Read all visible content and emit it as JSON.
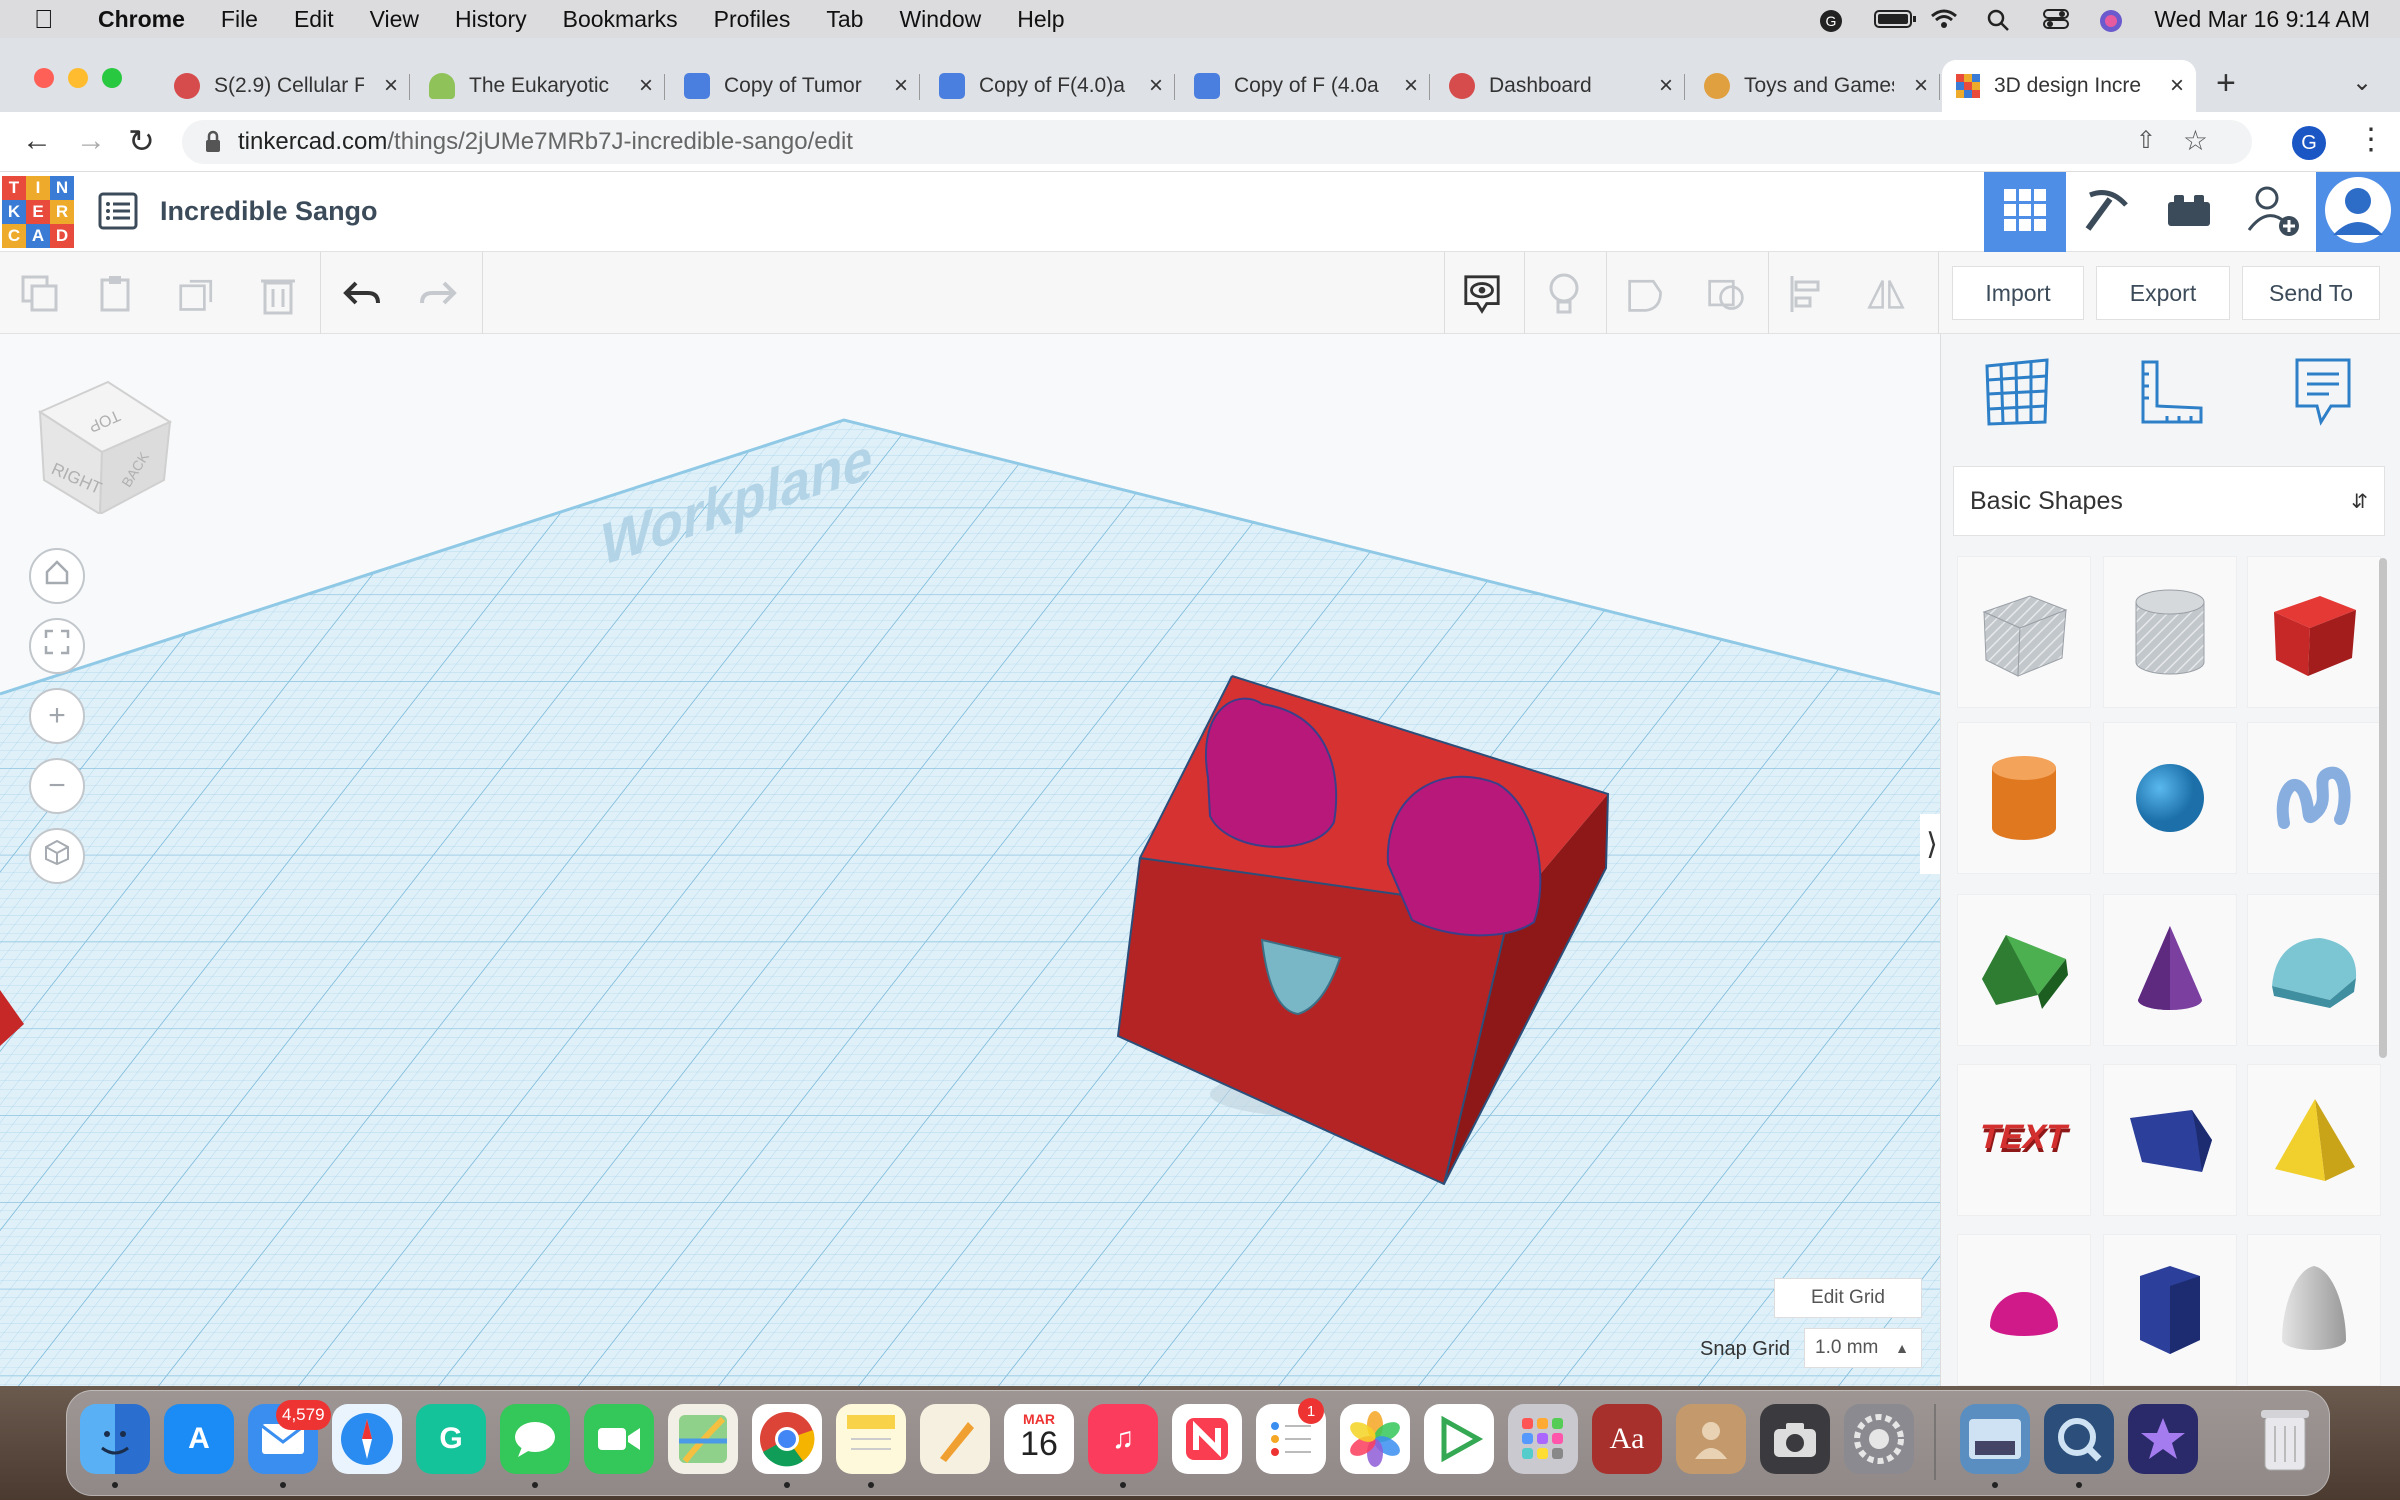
{
  "menubar": {
    "app": "Chrome",
    "items": [
      "File",
      "Edit",
      "View",
      "History",
      "Bookmarks",
      "Profiles",
      "Tab",
      "Window",
      "Help"
    ],
    "clock": "Wed Mar 16  9:14 AM"
  },
  "tabs": [
    {
      "title": "S(2.9) Cellular F",
      "color": "#d64b4b"
    },
    {
      "title": "The Eukaryotic",
      "color": "#8fc35a"
    },
    {
      "title": "Copy of Tumor",
      "color": "#4a7fe0"
    },
    {
      "title": "Copy of F(4.0)a",
      "color": "#4a7fe0"
    },
    {
      "title": "Copy of F (4.0a",
      "color": "#4a7fe0"
    },
    {
      "title": "Dashboard",
      "color": "#d64b4b"
    },
    {
      "title": "Toys and Games",
      "color": "#e0a040"
    },
    {
      "title": "3D design Incre",
      "color": "#e66"
    }
  ],
  "address": {
    "host": "tinkercad.com",
    "path": "/things/2jUMe7MRb7J-incredible-sango/edit",
    "profile_initial": "G"
  },
  "tinkercad": {
    "logo_letters": [
      "T",
      "I",
      "N",
      "K",
      "E",
      "R",
      "C",
      "A",
      "D"
    ],
    "design_title": "Incredible Sango",
    "buttons": {
      "import": "Import",
      "export": "Export",
      "send_to": "Send To"
    },
    "view_cube": {
      "top": "TOP",
      "right": "RIGHT",
      "back": "BACK"
    },
    "workplane_label": "Workplane",
    "edit_grid": "Edit Grid",
    "snap_grid_label": "Snap Grid",
    "snap_grid_value": "1.0 mm"
  },
  "panel": {
    "library": "Basic Shapes",
    "shapes": [
      {
        "name": "box-hole",
        "color": "#b9bec4"
      },
      {
        "name": "cylinder-hole",
        "color": "#b9bec4"
      },
      {
        "name": "box",
        "color": "#d32f2f"
      },
      {
        "name": "cylinder",
        "color": "#e07820"
      },
      {
        "name": "sphere",
        "color": "#2a8ac8"
      },
      {
        "name": "scribble",
        "color": "#7ea6d6"
      },
      {
        "name": "roof",
        "color": "#3c9a3c"
      },
      {
        "name": "cone",
        "color": "#7b3fa0"
      },
      {
        "name": "round-roof",
        "color": "#5ab0c0"
      },
      {
        "name": "text",
        "color": "#c62828"
      },
      {
        "name": "wedge",
        "color": "#25408f"
      },
      {
        "name": "pyramid",
        "color": "#e8c52a"
      },
      {
        "name": "half-sphere",
        "color": "#d11a8a"
      },
      {
        "name": "polygon",
        "color": "#2c3f9a"
      },
      {
        "name": "paraboloid",
        "color": "#c8c8c8"
      }
    ],
    "text_shape_label": "TEXT"
  },
  "dock": {
    "mail_badge": "4,579",
    "reminders_badge": "1",
    "calendar_month": "MAR",
    "calendar_day": "16"
  }
}
